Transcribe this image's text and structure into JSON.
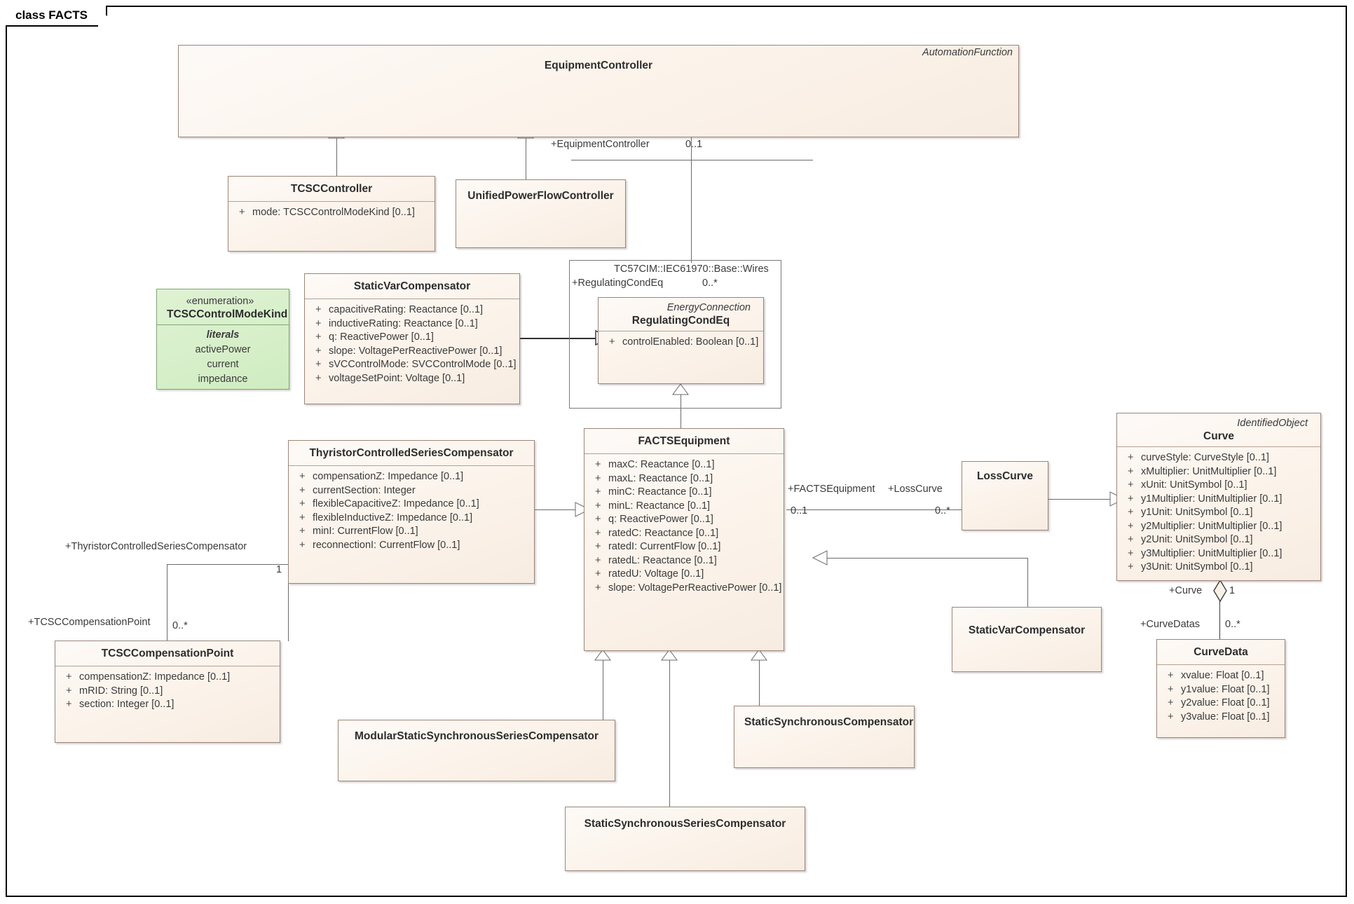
{
  "diagram": {
    "frame_label": "class FACTS"
  },
  "classes": {
    "equipment_controller": {
      "name": "EquipmentController",
      "stereotype": "AutomationFunction"
    },
    "tcsc_controller": {
      "name": "TCSCController",
      "attributes": [
        {
          "vis": "+",
          "text": "mode: TCSCControlModeKind [0..1]"
        }
      ]
    },
    "unified_power_flow_controller": {
      "name": "UnifiedPowerFlowController"
    },
    "tcsc_control_mode_kind": {
      "stereotype": "«enumeration»",
      "name": "TCSCControlModeKind",
      "literals_title": "literals",
      "literals": [
        "activePower",
        "current",
        "impedance"
      ]
    },
    "static_var_compensator_top": {
      "name": "StaticVarCompensator",
      "attributes": [
        {
          "vis": "+",
          "text": "capacitiveRating: Reactance [0..1]"
        },
        {
          "vis": "+",
          "text": "inductiveRating: Reactance [0..1]"
        },
        {
          "vis": "+",
          "text": "q: ReactivePower [0..1]"
        },
        {
          "vis": "+",
          "text": "slope: VoltagePerReactivePower [0..1]"
        },
        {
          "vis": "+",
          "text": "sVCControlMode: SVCControlMode [0..1]"
        },
        {
          "vis": "+",
          "text": "voltageSetPoint: Voltage [0..1]"
        }
      ]
    },
    "regulating_cond_eq": {
      "package": "TC57CIM::IEC61970::Base::Wires",
      "stereotype": "EnergyConnection",
      "name": "RegulatingCondEq",
      "attributes": [
        {
          "vis": "+",
          "text": "controlEnabled: Boolean [0..1]"
        }
      ]
    },
    "facts_equipment": {
      "name": "FACTSEquipment",
      "attributes": [
        {
          "vis": "+",
          "text": "maxC: Reactance [0..1]"
        },
        {
          "vis": "+",
          "text": "maxL: Reactance [0..1]"
        },
        {
          "vis": "+",
          "text": "minC: Reactance [0..1]"
        },
        {
          "vis": "+",
          "text": "minL: Reactance [0..1]"
        },
        {
          "vis": "+",
          "text": "q: ReactivePower [0..1]"
        },
        {
          "vis": "+",
          "text": "ratedC: Reactance [0..1]"
        },
        {
          "vis": "+",
          "text": "ratedI: CurrentFlow [0..1]"
        },
        {
          "vis": "+",
          "text": "ratedL: Reactance [0..1]"
        },
        {
          "vis": "+",
          "text": "ratedU: Voltage [0..1]"
        },
        {
          "vis": "+",
          "text": "slope: VoltagePerReactivePower [0..1]"
        }
      ]
    },
    "thyristor_controlled_series_compensator": {
      "name": "ThyristorControlledSeriesCompensator",
      "attributes": [
        {
          "vis": "+",
          "text": "compensationZ: Impedance [0..1]"
        },
        {
          "vis": "+",
          "text": "currentSection: Integer"
        },
        {
          "vis": "+",
          "text": "flexibleCapacitiveZ: Impedance [0..1]"
        },
        {
          "vis": "+",
          "text": "flexibleInductiveZ: Impedance [0..1]"
        },
        {
          "vis": "+",
          "text": "minI: CurrentFlow [0..1]"
        },
        {
          "vis": "+",
          "text": "reconnectionI: CurrentFlow [0..1]"
        }
      ]
    },
    "tcsc_compensation_point": {
      "name": "TCSCCompensationPoint",
      "attributes": [
        {
          "vis": "+",
          "text": "compensationZ: Impedance [0..1]"
        },
        {
          "vis": "+",
          "text": "mRID: String [0..1]"
        },
        {
          "vis": "+",
          "text": "section: Integer [0..1]"
        }
      ]
    },
    "loss_curve": {
      "name": "LossCurve"
    },
    "curve": {
      "stereotype": "IdentifiedObject",
      "name": "Curve",
      "attributes": [
        {
          "vis": "+",
          "text": "curveStyle: CurveStyle [0..1]"
        },
        {
          "vis": "+",
          "text": "xMultiplier: UnitMultiplier [0..1]"
        },
        {
          "vis": "+",
          "text": "xUnit: UnitSymbol [0..1]"
        },
        {
          "vis": "+",
          "text": "y1Multiplier: UnitMultiplier [0..1]"
        },
        {
          "vis": "+",
          "text": "y1Unit: UnitSymbol [0..1]"
        },
        {
          "vis": "+",
          "text": "y2Multiplier: UnitMultiplier [0..1]"
        },
        {
          "vis": "+",
          "text": "y2Unit: UnitSymbol [0..1]"
        },
        {
          "vis": "+",
          "text": "y3Multiplier: UnitMultiplier [0..1]"
        },
        {
          "vis": "+",
          "text": "y3Unit: UnitSymbol [0..1]"
        }
      ]
    },
    "curve_data": {
      "name": "CurveData",
      "attributes": [
        {
          "vis": "+",
          "text": "xvalue: Float [0..1]"
        },
        {
          "vis": "+",
          "text": "y1value: Float [0..1]"
        },
        {
          "vis": "+",
          "text": "y2value: Float [0..1]"
        },
        {
          "vis": "+",
          "text": "y3value: Float [0..1]"
        }
      ]
    },
    "static_var_compensator_bottom": {
      "name": "StaticVarCompensator"
    },
    "modular_static_synchronous_series_compensator": {
      "name": "ModularStaticSynchronousSeriesCompensator"
    },
    "static_synchronous_compensator": {
      "name": "StaticSynchronousCompensator"
    },
    "static_synchronous_series_compensator": {
      "name": "StaticSynchronousSeriesCompensator"
    }
  },
  "connector_labels": {
    "equipment_controller_role": "+EquipmentController",
    "equipment_controller_mult": "0..1",
    "regulating_cond_eq_role": "+RegulatingCondEq",
    "regulating_cond_eq_mult": "0..*",
    "facts_equipment_role": "+FACTSEquipment",
    "facts_equipment_mult": "0..1",
    "loss_curve_role": "+LossCurve",
    "loss_curve_mult": "0..*",
    "curve_role": "+Curve",
    "curve_mult": "1",
    "curve_datas_role": "+CurveDatas",
    "curve_datas_mult": "0..*",
    "tcsc_role": "+ThyristorControlledSeriesCompensator",
    "tcsc_mult": "1",
    "tcsc_point_role": "+TCSCCompensationPoint",
    "tcsc_point_mult": "0..*"
  },
  "colors": {
    "class_border": "#9b8579",
    "class_fill_light": "#fdfaf7",
    "class_fill_dark": "#f7ece1",
    "enum_border": "#7fa86f",
    "enum_fill": "#d6efc9",
    "connector": "#6b6b6b",
    "frame": "#000000"
  }
}
